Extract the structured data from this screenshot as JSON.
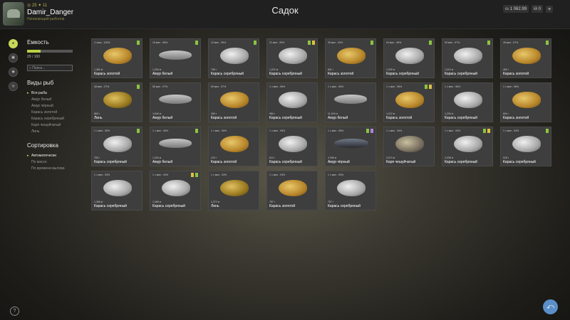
{
  "header": {
    "title": "Садок",
    "player": {
      "stats": "◎ 25  ✦ 11",
      "name": "Damir_Danger",
      "subtitle": "Начинающий рыболов"
    },
    "currency": {
      "silver": "1 062.99",
      "gold": "0"
    }
  },
  "sidebar": {
    "capacity_title": "Емкость",
    "capacity_value": "29 / 100",
    "capacity_fraction": 0.29,
    "search_placeholder": "Поиск...",
    "species_title": "Виды рыб",
    "species": [
      {
        "label": "Вся рыба",
        "selected": true
      },
      {
        "label": "Амур белый",
        "selected": false
      },
      {
        "label": "Амур чёрный",
        "selected": false
      },
      {
        "label": "Карась золотой",
        "selected": false
      },
      {
        "label": "Карась серебряный",
        "selected": false
      },
      {
        "label": "Карп чешуйчатый",
        "selected": false
      },
      {
        "label": "Линь",
        "selected": false
      }
    ],
    "sort_title": "Сортировка",
    "sort": [
      {
        "label": "Автоматически",
        "selected": true
      },
      {
        "label": "По массе",
        "selected": false
      },
      {
        "label": "По времени вылова",
        "selected": false
      }
    ]
  },
  "fish_cards": [
    {
      "top": "4 часа - 100%",
      "weight": "1,360 кг",
      "name": "Карась золотой",
      "kind": "gold",
      "flags": [
        "#8ac440"
      ]
    },
    {
      "top": "15 мин - 98%",
      "weight": "1,334 кг",
      "name": "Амур белый",
      "kind": "amur",
      "flags": [
        "#8ac440"
      ]
    },
    {
      "top": "13 мин - 99%",
      "weight": "798 г",
      "name": "Карась серебряный",
      "kind": "silver",
      "flags": [
        "#8ac440"
      ]
    },
    {
      "top": "21 мин - 99%",
      "weight": "1,022 кг",
      "name": "Карась серебряный",
      "kind": "silver",
      "flags": [
        "#e0c040",
        "#8ac440"
      ]
    },
    {
      "top": "28 мин - 99%",
      "weight": "691 г",
      "name": "Карась золотой",
      "kind": "gold",
      "flags": [
        "#8ac440"
      ]
    },
    {
      "top": "34 мин - 98%",
      "weight": "1,009 кг",
      "name": "Карась серебряный",
      "kind": "silver",
      "flags": [
        "#8ac440"
      ]
    },
    {
      "top": "39 мин - 97%",
      "weight": "1,010 кг",
      "name": "Карась серебряный",
      "kind": "silver",
      "flags": [
        "#8ac440"
      ]
    },
    {
      "top": "45 мин - 97%",
      "weight": "453 г",
      "name": "Карась золотой",
      "kind": "gold",
      "flags": [
        "#8ac440"
      ]
    },
    {
      "top": "48 мин - 97%",
      "weight": "863 г",
      "name": "Линь",
      "kind": "tench",
      "flags": [
        "#8ac440"
      ]
    },
    {
      "top": "55 мин - 97%",
      "weight": "1,840 кг",
      "name": "Амур белый",
      "kind": "amur",
      "flags": []
    },
    {
      "top": "59 мин - 97%",
      "weight": "269 г",
      "name": "Карась золотой",
      "kind": "gold",
      "flags": []
    },
    {
      "top": "1 ч мин - 96%",
      "weight": "984 г",
      "name": "Карась серебряный",
      "kind": "silver",
      "flags": []
    },
    {
      "top": "1 ч мин - 96%",
      "weight": "11,419 кг",
      "name": "Амур белый",
      "kind": "amur",
      "flags": []
    },
    {
      "top": "1 ч мин - 96%",
      "weight": "1,012 кг",
      "name": "Карась золотой",
      "kind": "gold",
      "flags": [
        "#e0c040",
        "#8ac440"
      ]
    },
    {
      "top": "1 ч мин - 96%",
      "weight": "1,226 кг",
      "name": "Карась серебряный",
      "kind": "silver",
      "flags": []
    },
    {
      "top": "1 ч мин - 96%",
      "weight": "694 г",
      "name": "Карась золотой",
      "kind": "gold",
      "flags": []
    },
    {
      "top": "1 ч мин - 96%",
      "weight": "783 г",
      "name": "Карась серебряный",
      "kind": "silver",
      "flags": [
        "#8ac440"
      ]
    },
    {
      "top": "1 ч мин - 96%",
      "weight": "1,334 кг",
      "name": "Амур белый",
      "kind": "amur",
      "flags": [
        "#8ac440"
      ]
    },
    {
      "top": "1 ч мин - 96%",
      "weight": "215 г",
      "name": "Карась золотой",
      "kind": "gold",
      "flags": []
    },
    {
      "top": "1 ч мин - 95%",
      "weight": "812 г",
      "name": "Карась серебряный",
      "kind": "silver",
      "flags": []
    },
    {
      "top": "1 ч мин - 95%",
      "weight": "2,096 кг",
      "name": "Амур чёрный",
      "kind": "black",
      "flags": [
        "#b080e0",
        "#8ac440"
      ]
    },
    {
      "top": "1 ч мин - 94%",
      "weight": "3,074 кг",
      "name": "Карп чешуйчатый",
      "kind": "carp",
      "flags": []
    },
    {
      "top": "1 ч мин - 94%",
      "weight": "2,038 кг",
      "name": "Карась серебряный",
      "kind": "silver",
      "flags": [
        "#e0c040",
        "#8ac440"
      ]
    },
    {
      "top": "1 ч мин - 94%",
      "weight": "918 г",
      "name": "Карась серебряный",
      "kind": "silver",
      "flags": [
        "#8ac440"
      ]
    },
    {
      "top": "1 ч мин - 94%",
      "weight": "1,368 кг",
      "name": "Карась серебряный",
      "kind": "silver",
      "flags": []
    },
    {
      "top": "1 ч мин - 94%",
      "weight": "1,068 кг",
      "name": "Карась серебряный",
      "kind": "silver",
      "flags": [
        "#8ac440",
        "#e0c040"
      ]
    },
    {
      "top": "1 ч мин - 93%",
      "weight": "1,372 кг",
      "name": "Линь",
      "kind": "tench",
      "flags": []
    },
    {
      "top": "1 ч мин - 93%",
      "weight": "757 г",
      "name": "Карась золотой",
      "kind": "gold",
      "flags": []
    },
    {
      "top": "1 ч мин - 93%",
      "weight": "757 г",
      "name": "Карась серебряный",
      "kind": "silver",
      "flags": []
    }
  ]
}
